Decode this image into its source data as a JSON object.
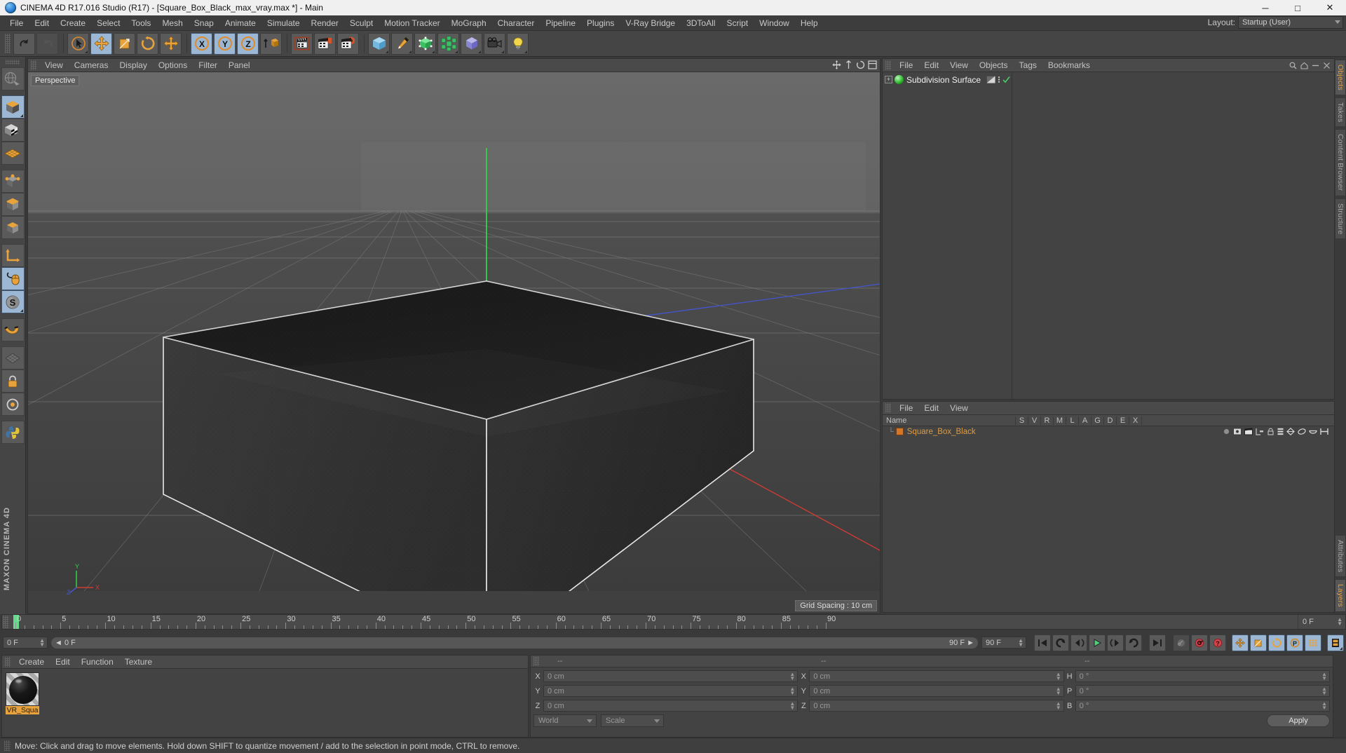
{
  "titlebar": {
    "title": "CINEMA 4D R17.016 Studio (R17) - [Square_Box_Black_max_vray.max *] - Main",
    "app_icon": "c4d-logo-icon",
    "minimize": "─",
    "maximize": "□",
    "close": "✕"
  },
  "menubar": {
    "items": [
      "File",
      "Edit",
      "Create",
      "Select",
      "Tools",
      "Mesh",
      "Snap",
      "Animate",
      "Simulate",
      "Render",
      "Sculpt",
      "Motion Tracker",
      "MoGraph",
      "Character",
      "Pipeline",
      "Plugins",
      "V-Ray Bridge",
      "3DToAll",
      "Script",
      "Window",
      "Help"
    ],
    "layout_label": "Layout:",
    "layout_value": "Startup (User)"
  },
  "toolbar": {
    "groups": [
      {
        "name": "history",
        "buttons": [
          {
            "name": "undo-button",
            "icon": "undo-arrow-icon",
            "state": "normal"
          },
          {
            "name": "redo-button",
            "icon": "redo-arrow-icon",
            "state": "dim"
          }
        ]
      },
      {
        "name": "transform",
        "buttons": [
          {
            "name": "live-selection-button",
            "icon": "cursor-circle-icon",
            "state": "normal"
          },
          {
            "name": "move-tool-button",
            "icon": "move-cross-icon",
            "state": "active"
          },
          {
            "name": "scale-tool-button",
            "icon": "scale-box-icon",
            "state": "normal"
          },
          {
            "name": "rotate-tool-button",
            "icon": "rotate-circle-icon",
            "state": "normal"
          },
          {
            "name": "move-duplicate-button",
            "icon": "move-cross-icon",
            "state": "normal"
          }
        ]
      },
      {
        "name": "axis-locks",
        "buttons": [
          {
            "name": "lock-x-axis-button",
            "icon": "x-axis-icon",
            "state": "active"
          },
          {
            "name": "lock-y-axis-button",
            "icon": "y-axis-icon",
            "state": "active"
          },
          {
            "name": "lock-z-axis-button",
            "icon": "z-axis-icon",
            "state": "active"
          },
          {
            "name": "world-object-coord-button",
            "icon": "world-cube-icon",
            "state": "normal"
          }
        ]
      },
      {
        "name": "render",
        "buttons": [
          {
            "name": "render-view-button",
            "icon": "clapper-icon",
            "state": "normal"
          },
          {
            "name": "render-to-picture-viewer-button",
            "icon": "clapper-picture-icon",
            "state": "normal"
          },
          {
            "name": "render-settings-button",
            "icon": "clapper-gear-icon",
            "state": "normal"
          }
        ]
      },
      {
        "name": "primitives",
        "buttons": [
          {
            "name": "add-cube-button",
            "icon": "cube-icon",
            "state": "normal"
          },
          {
            "name": "add-spline-button",
            "icon": "pen-icon",
            "state": "normal"
          },
          {
            "name": "generator-button",
            "icon": "nurbs-icon",
            "state": "normal"
          },
          {
            "name": "array-button",
            "icon": "array-icon",
            "state": "normal"
          },
          {
            "name": "bend-deformer-button",
            "icon": "deformer-icon",
            "state": "normal"
          },
          {
            "name": "camera-button",
            "icon": "camera-icon",
            "state": "normal"
          },
          {
            "name": "light-button",
            "icon": "light-bulb-icon",
            "state": "normal"
          }
        ]
      }
    ]
  },
  "leftbar": {
    "buttons": [
      {
        "name": "viewport-mode-button",
        "icon": "globe-wire-icon",
        "state": "normal"
      },
      {
        "name": "make-editable-button",
        "icon": "cube-orange-icon",
        "state": "active"
      },
      {
        "name": "texture-axis-button",
        "icon": "checker-cube-icon",
        "state": "normal"
      },
      {
        "name": "uv-mesh-button",
        "icon": "uv-grid-icon",
        "state": "normal"
      },
      {
        "name": "points-mode-button",
        "icon": "points-cube-icon",
        "state": "normal"
      },
      {
        "name": "edges-mode-button",
        "icon": "edges-cube-icon",
        "state": "normal"
      },
      {
        "name": "polygons-mode-button",
        "icon": "polygon-cube-icon",
        "state": "normal"
      },
      {
        "name": "object-axis-button",
        "icon": "axis-l-icon",
        "state": "normal"
      },
      {
        "name": "enable-axis-button",
        "icon": "mouse-icon",
        "state": "active"
      },
      {
        "name": "snap-settings-button",
        "icon": "snap-s-icon",
        "state": "active"
      },
      {
        "name": "magnet-button",
        "icon": "magnet-icon",
        "state": "normal"
      },
      {
        "name": "workplane-button",
        "icon": "workplane-icon",
        "state": "normal"
      },
      {
        "name": "lock-workplane-button",
        "icon": "lock-icon",
        "state": "normal"
      },
      {
        "name": "viewport-solo-button",
        "icon": "solo-icon",
        "state": "normal"
      },
      {
        "name": "python-button",
        "icon": "python-icon",
        "state": "normal"
      }
    ],
    "brand_line1": "MAXON",
    "brand_line2": "CINEMA 4D"
  },
  "viewport": {
    "menu": [
      "View",
      "Cameras",
      "Display",
      "Options",
      "Filter",
      "Panel"
    ],
    "label": "Perspective",
    "grid_spacing": "Grid Spacing : 10 cm",
    "axis_labels": {
      "x": "X",
      "y": "Y",
      "z": "Z"
    },
    "icons": [
      "move-view-icon",
      "scale-view-icon",
      "rotate-view-icon",
      "maximize-view-icon"
    ]
  },
  "object_manager": {
    "menu": [
      "File",
      "Edit",
      "View",
      "Objects",
      "Tags",
      "Bookmarks"
    ],
    "rows": [
      {
        "name": "Subdivision Surface",
        "expand": "+",
        "icon": "subdivision-surface-icon",
        "tags": [
          "visibility-tag",
          "dots-tag",
          "check-tag"
        ]
      }
    ]
  },
  "attribute_manager": {
    "menu": [
      "File",
      "Edit",
      "View"
    ],
    "columns": [
      "Name",
      "S",
      "V",
      "R",
      "M",
      "L",
      "A",
      "G",
      "D",
      "E",
      "X"
    ],
    "rows": [
      {
        "name": "Square_Box_Black",
        "icons": [
          "dot-icon",
          "display-icon",
          "render-icon",
          "compositing-icon",
          "lock-icon",
          "layer-icon",
          "generate-icon",
          "deform-icon",
          "dynamics-icon",
          "xpresso-icon"
        ]
      }
    ]
  },
  "right_tabs": {
    "top": [
      "Objects",
      "Takes",
      "Content Browser",
      "Structure"
    ],
    "top_active": "Objects",
    "bottom": [
      "Attributes",
      "Layers"
    ],
    "bottom_active": "Layers"
  },
  "timeline": {
    "ticks": [
      0,
      5,
      10,
      15,
      20,
      25,
      30,
      35,
      40,
      45,
      50,
      55,
      60,
      65,
      70,
      75,
      80,
      85,
      90
    ],
    "current_frame_field": "0 F",
    "range_start": "0 F",
    "range_end": "90 F",
    "max_frame_field": "90 F",
    "end_frame_right": "0 F",
    "playhead_frame": 0,
    "transport": [
      {
        "name": "go-to-start-button",
        "icon": "skip-start-icon",
        "state": "normal"
      },
      {
        "name": "play-backwards-button",
        "icon": "rewind-loop-icon",
        "state": "normal"
      },
      {
        "name": "previous-frame-button",
        "icon": "step-back-icon",
        "state": "normal"
      },
      {
        "name": "play-forwards-button",
        "icon": "play-icon",
        "state": "normal"
      },
      {
        "name": "next-frame-button",
        "icon": "step-forward-icon",
        "state": "normal"
      },
      {
        "name": "play-loop-button",
        "icon": "loop-icon",
        "state": "normal"
      },
      {
        "name": "go-to-end-button",
        "icon": "skip-end-icon",
        "state": "normal"
      }
    ],
    "keyframe_tools": [
      {
        "name": "record-active-objects-button",
        "icon": "key-icon",
        "state": "dim"
      },
      {
        "name": "autokeying-button",
        "icon": "auto-key-icon",
        "state": "normal"
      },
      {
        "name": "keyframe-selection-button",
        "icon": "question-key-icon",
        "state": "normal"
      },
      {
        "name": "position-key-button",
        "icon": "move-cross-icon",
        "state": "active"
      },
      {
        "name": "scale-key-button",
        "icon": "scale-box-icon",
        "state": "active"
      },
      {
        "name": "rotation-key-button",
        "icon": "rotate-circle-icon",
        "state": "active"
      },
      {
        "name": "parameter-key-button",
        "icon": "p-circle-icon",
        "state": "active"
      },
      {
        "name": "point-level-animation-button",
        "icon": "dots-grid-icon",
        "state": "active"
      },
      {
        "name": "timeline-button",
        "icon": "filmstrip-icon",
        "state": "active"
      }
    ]
  },
  "material_manager": {
    "menu": [
      "Create",
      "Edit",
      "Function",
      "Texture"
    ],
    "materials": [
      {
        "name": "VR_Squa",
        "preview": "black-sphere-preview"
      }
    ]
  },
  "coordinates": {
    "headers": [
      "--",
      "--",
      "--"
    ],
    "rows": [
      {
        "pos_label": "X",
        "pos_value": "0 cm",
        "size_label": "X",
        "size_value": "0 cm",
        "rot_label": "H",
        "rot_value": "0 °"
      },
      {
        "pos_label": "Y",
        "pos_value": "0 cm",
        "size_label": "Y",
        "size_value": "0 cm",
        "rot_label": "P",
        "rot_value": "0 °"
      },
      {
        "pos_label": "Z",
        "pos_value": "0 cm",
        "size_label": "Z",
        "size_value": "0 cm",
        "rot_label": "B",
        "rot_value": "0 °"
      }
    ],
    "system_dropdown": "World",
    "mode_dropdown": "Scale",
    "apply_button": "Apply"
  },
  "statusbar": {
    "message": "Move: Click and drag to move elements. Hold down SHIFT to quantize movement / add to the selection in point mode, CTRL to remove."
  },
  "colors": {
    "accent_orange": "#e8a33d",
    "active_blue": "#9bb7d4",
    "panel_bg": "#434343",
    "chrome_bg": "#454545",
    "playhead_green": "#64dc8c",
    "x_axis_red": "#c0392b",
    "y_axis_green": "#2ecc40",
    "z_axis_blue": "#3b5bdb"
  }
}
